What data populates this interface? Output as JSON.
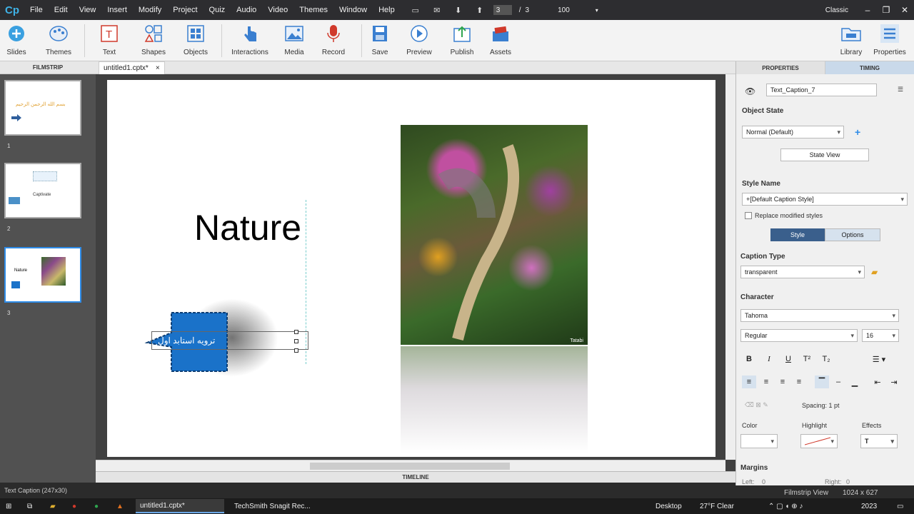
{
  "menubar": {
    "logo": "Cp",
    "items": [
      "File",
      "Edit",
      "View",
      "Insert",
      "Modify",
      "Project",
      "Quiz",
      "Audio",
      "Video",
      "Themes",
      "Window",
      "Help"
    ],
    "current_slide": "3",
    "separator": "/",
    "total_slides": "3",
    "zoom": "100",
    "workspace": "Classic"
  },
  "toolbar": {
    "slides": "Slides",
    "themes": "Themes",
    "text": "Text",
    "shapes": "Shapes",
    "objects": "Objects",
    "interactions": "Interactions",
    "media": "Media",
    "record": "Record",
    "save": "Save",
    "preview": "Preview",
    "publish": "Publish",
    "assets": "Assets",
    "library": "Library",
    "properties": "Properties"
  },
  "filmstrip": {
    "header": "FILMSTRIP",
    "slides": [
      {
        "number": "1",
        "title_text": "بسم الله الرحمن الرحيم"
      },
      {
        "number": "2",
        "title_text": "Captivate"
      },
      {
        "number": "3",
        "title_text": "Nature"
      }
    ]
  },
  "document": {
    "tab_title": "untitled1.cptx*",
    "close": "×"
  },
  "stage": {
    "title": "Nature",
    "caption_text": "ترويه استابد اول",
    "image_watermark": "Tatabi"
  },
  "timeline": {
    "label": "TIMELINE"
  },
  "properties": {
    "tab_properties": "PROPERTIES",
    "tab_timing": "TIMING",
    "object_name": "Text_Caption_7",
    "object_state_label": "Object State",
    "object_state_value": "Normal (Default)",
    "state_view": "State View",
    "style_name_label": "Style Name",
    "style_name_value": "+[Default Caption Style]",
    "replace_modified": "Replace modified styles",
    "style_tab": "Style",
    "options_tab": "Options",
    "caption_type_label": "Caption Type",
    "caption_type_value": "transparent",
    "character_label": "Character",
    "font": "Tahoma",
    "font_style": "Regular",
    "font_size": "16",
    "bold": "B",
    "italic": "I",
    "underline": "U",
    "superscript": "T²",
    "subscript": "T₂",
    "spacing": "Spacing: 1 pt",
    "color_label": "Color",
    "highlight_label": "Highlight",
    "effects_label": "Effects",
    "effects_value": "T",
    "margins_label": "Margins",
    "left_label": "Left:",
    "left_value": "0",
    "right_label": "Right:",
    "right_value": "0"
  },
  "status": {
    "object_info": "Text Caption (247x30)",
    "view_mode": "Filmstrip View",
    "resolution": "1024 x 627"
  },
  "taskbar": {
    "app1": "untitled1.cptx*",
    "app2": "TechSmith Snagit Rec...",
    "desktop": "Desktop",
    "weather": "27°F  Clear",
    "year": "2023"
  },
  "colors": {
    "accent": "#2e8ce8",
    "caption_blue": "#1a72c9",
    "menubar": "#2d2d30"
  }
}
